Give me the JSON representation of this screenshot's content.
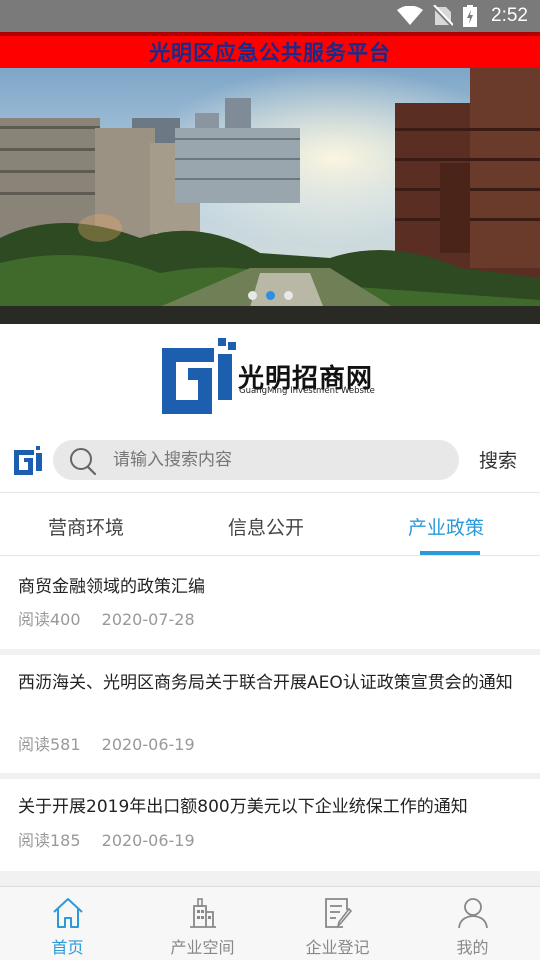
{
  "status_bar": {
    "time": "2:52",
    "icons": [
      "wifi-icon",
      "no-sim-icon",
      "battery-icon"
    ]
  },
  "header": {
    "title": "光明区应急公共服务平台"
  },
  "carousel": {
    "slide_count": 3,
    "active_index": 1
  },
  "logo": {
    "name": "光明招商网",
    "subtitle": "GuangMing Investment Website"
  },
  "search": {
    "placeholder": "请输入搜索内容",
    "value": "",
    "button_label": "搜索"
  },
  "tabs": [
    {
      "label": "营商环境",
      "active": false
    },
    {
      "label": "信息公开",
      "active": false
    },
    {
      "label": "产业政策",
      "active": true
    }
  ],
  "articles": [
    {
      "title": "商贸金融领域的政策汇编",
      "reads": "阅读400",
      "date": "2020-07-28"
    },
    {
      "title": "西沥海关、光明区商务局关于联合开展AEO认证政策宣贯会的通知",
      "reads": "阅读581",
      "date": "2020-06-19"
    },
    {
      "title": "关于开展2019年出口额800万美元以下企业统保工作的通知",
      "reads": "阅读185",
      "date": "2020-06-19"
    }
  ],
  "bottom_nav": [
    {
      "label": "首页",
      "icon": "home-icon",
      "active": true
    },
    {
      "label": "产业空间",
      "icon": "building-icon",
      "active": false
    },
    {
      "label": "企业登记",
      "icon": "edit-document-icon",
      "active": false
    },
    {
      "label": "我的",
      "icon": "user-icon",
      "active": false
    }
  ],
  "colors": {
    "accent": "#2a9ad8",
    "header_bg": "#ff0000",
    "header_text": "#1a2a8a",
    "logo_blue": "#1b5fae"
  }
}
